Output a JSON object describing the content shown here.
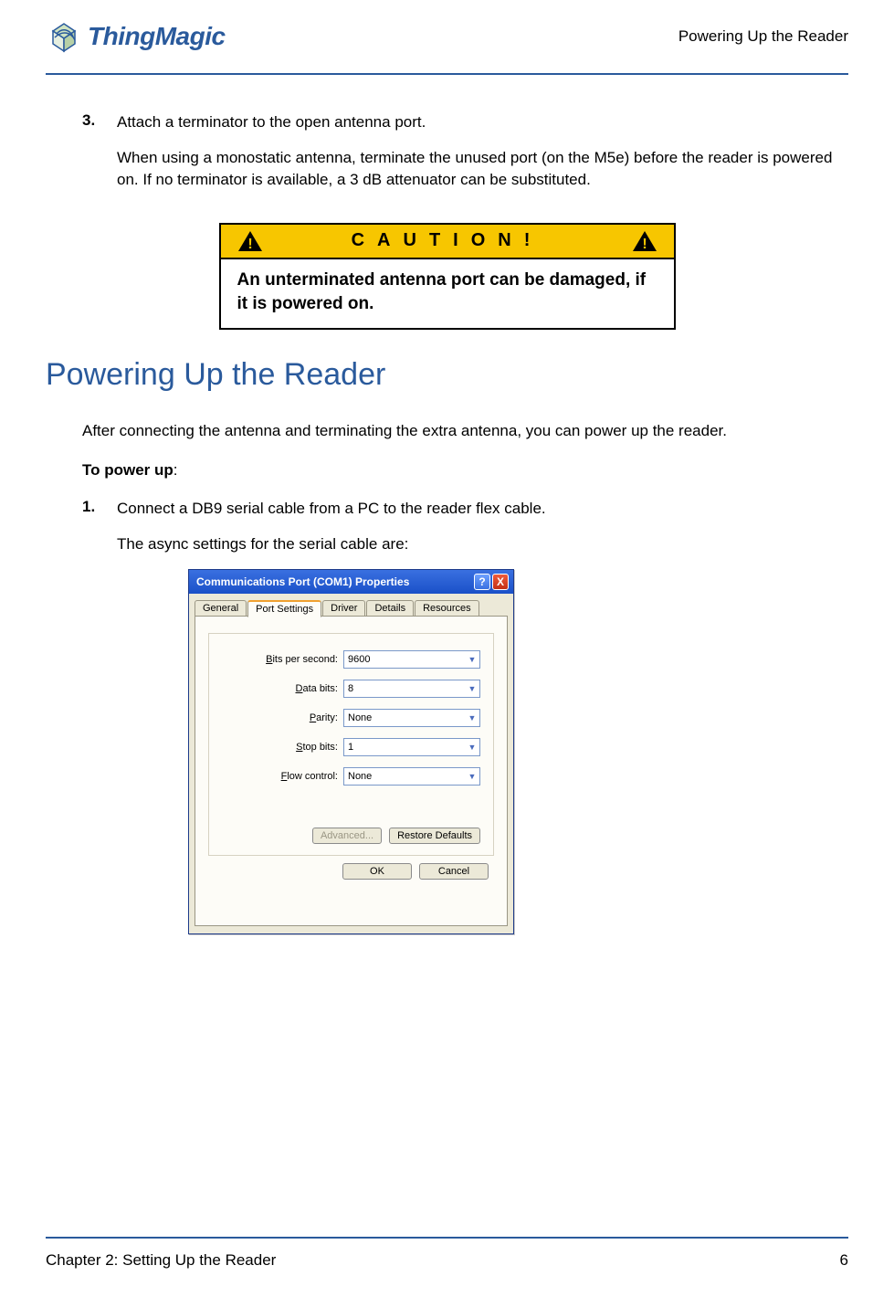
{
  "header": {
    "brand": "ThingMagic",
    "right": "Powering Up the Reader"
  },
  "step3": {
    "num": "3.",
    "title": "Attach a terminator to the open antenna port.",
    "body": "When using a monostatic antenna, terminate the unused port (on the M5e) before the reader is powered on. If no terminator is available, a 3 dB attenuator can be substituted."
  },
  "caution": {
    "label": "CAUTION!",
    "body": "An unterminated antenna port can be dam­aged, if it is powered on."
  },
  "section_title": "Powering Up the Reader",
  "intro": "After connecting the antenna and terminating the extra antenna, you can power up the reader.",
  "to_power_up_label": "To power up",
  "to_power_up_colon": ":",
  "step1": {
    "num": "1.",
    "title": "Connect a DB9 serial cable from a PC to the reader flex cable.",
    "body": "The async settings for the serial cable are:"
  },
  "dialog": {
    "title": "Communications Port (COM1) Properties",
    "tabs": [
      "General",
      "Port Settings",
      "Driver",
      "Details",
      "Resources"
    ],
    "active_tab": 1,
    "fields": {
      "bits_label_pre": "B",
      "bits_label_post": "its per second:",
      "bits_value": "9600",
      "data_label_pre": "D",
      "data_label_post": "ata bits:",
      "data_value": "8",
      "parity_label_pre": "P",
      "parity_label_post": "arity:",
      "parity_value": "None",
      "stop_label_pre": "S",
      "stop_label_post": "top bits:",
      "stop_value": "1",
      "flow_label_pre": "F",
      "flow_label_post": "low control:",
      "flow_value": "None"
    },
    "buttons": {
      "advanced_pre": "A",
      "advanced_post": "dvanced...",
      "restore_pre": "R",
      "restore_post": "estore Defaults",
      "ok": "OK",
      "cancel": "Cancel",
      "help": "?",
      "close": "X"
    }
  },
  "footer": {
    "left": "Chapter 2: Setting Up the Reader",
    "right": "6"
  }
}
